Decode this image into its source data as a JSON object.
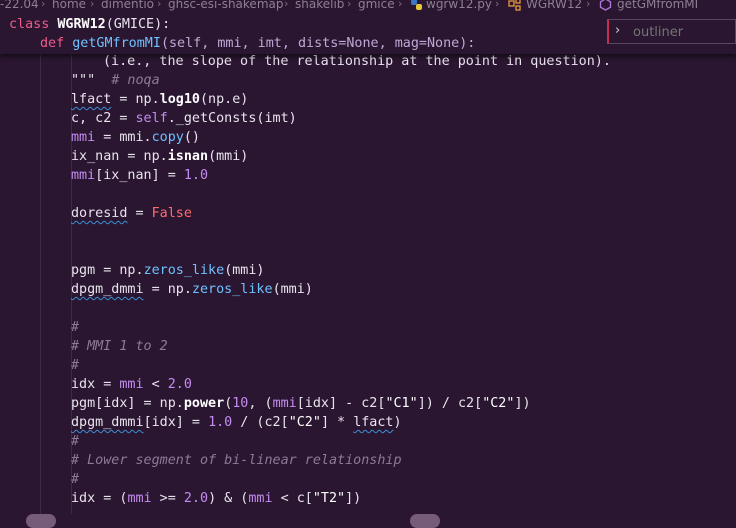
{
  "breadcrumb": {
    "items": [
      "-22.04",
      "home",
      "dimentio",
      "ghsc-esi-shakemap",
      "shakelib",
      "gmice",
      "wgrw12.py",
      "WGRW12",
      "getGMfromMI"
    ],
    "sep": "›"
  },
  "outliner": {
    "placeholder": "outliner",
    "chevron": "›"
  },
  "code": {
    "class_kw": "class",
    "class_name": "WGRW12",
    "class_tail": "(GMICE):",
    "def_kw": "def",
    "def_name": "getGMfromMI",
    "def_args": "(self, mmi, imt, dists=None, mag=None):",
    "doc_line": "(i.e., the slope of the relationship at the point in question).",
    "doc_end": "\"\"\"",
    "noqa": "# noqa",
    "lines": {
      "l1a": "lfact",
      "l1b": " = np.",
      "l1c": "log10",
      "l1d": "(np.e)",
      "l2a": "c, c2 = ",
      "l2b": "self",
      "l2c": "._getConsts(imt)",
      "l3a": "mmi",
      "l3b": " = mmi.",
      "l3c": "copy",
      "l3d": "()",
      "l4a": "ix_nan = np.",
      "l4b": "isnan",
      "l4c": "(mmi)",
      "l5a": "mmi",
      "l5b": "[ix_nan] = ",
      "l5c": "1.0",
      "l6a": "doresid",
      "l6b": " = ",
      "l6c": "False",
      "l7a": "pgm = np.",
      "l7b": "zeros_like",
      "l7c": "(mmi)",
      "l8a": "dpgm_dmmi",
      "l8b": " = np.",
      "l8c": "zeros_like",
      "l8d": "(mmi)",
      "c1": "#",
      "c2": "# MMI 1 to 2",
      "c3": "#",
      "l9a": "idx = ",
      "l9b": "mmi",
      "l9c": " < ",
      "l9d": "2.0",
      "l10a": "pgm[idx] = np.",
      "l10b": "power",
      "l10c": "(",
      "l10d": "10",
      "l10e": ", (",
      "l10f": "mmi",
      "l10g": "[idx] - c2[",
      "l10h": "\"C1\"",
      "l10i": "]) / c2[",
      "l10j": "\"C2\"",
      "l10k": "])",
      "l11a": "dpgm_dmmi",
      "l11b": "[idx] = ",
      "l11c": "1.0",
      "l11d": " / (c2[",
      "l11e": "\"C2\"",
      "l11f": "] * ",
      "l11g": "lfact",
      "l11h": ")",
      "c4": "#",
      "c5": "# Lower segment of bi-linear relationship",
      "c6": "#",
      "l12a": "idx = (",
      "l12b": "mmi",
      "l12c": " >= ",
      "l12d": "2.0",
      "l12e": ") & (",
      "l12f": "mmi",
      "l12g": " < c[",
      "l12h": "\"T2\"",
      "l12i": "])"
    }
  },
  "colors": {
    "background": "#2a1630",
    "keyword": "#f05a8c",
    "function": "#6fc0ff",
    "number": "#c38cf0",
    "constant": "#ff6d6d",
    "comment": "#8d7a99"
  },
  "icons": {
    "python_file": "python-icon",
    "class": "class-icon",
    "method": "method-icon"
  }
}
